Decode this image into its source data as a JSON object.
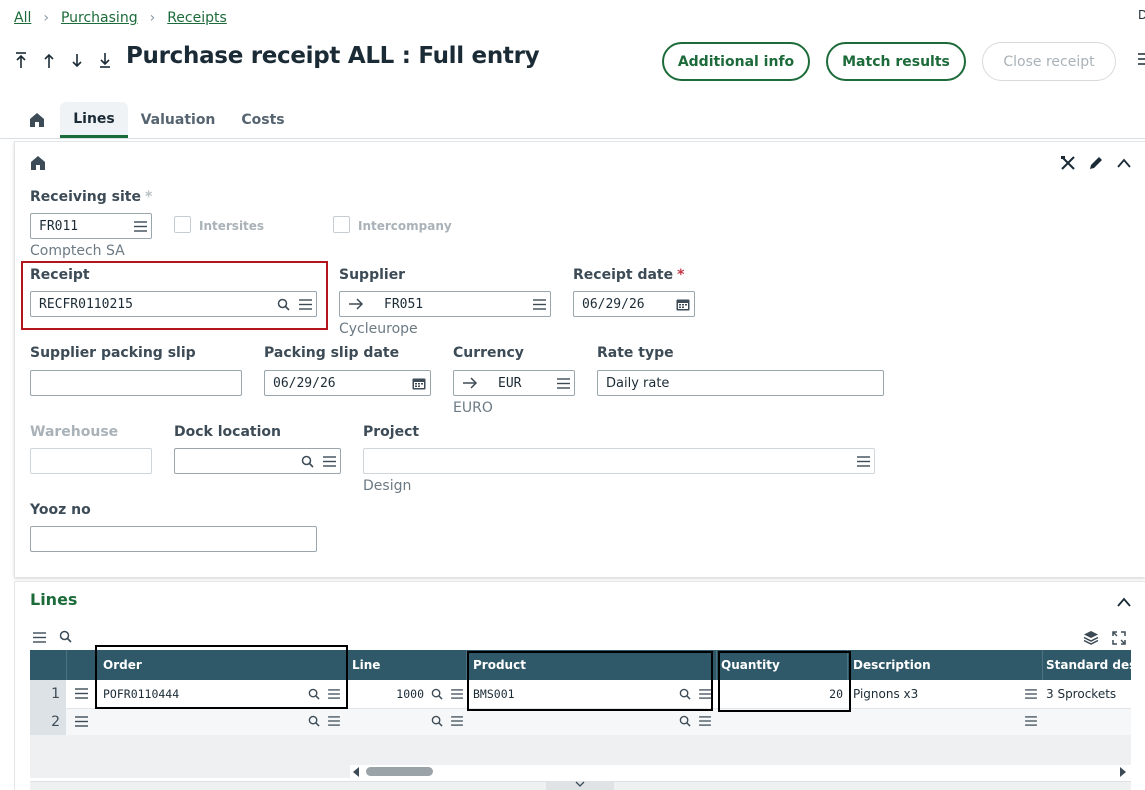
{
  "breadcrumb": [
    "All",
    "Purchasing",
    "Receipts"
  ],
  "title": "Purchase receipt ALL : Full entry",
  "buttons": {
    "additional_info": "Additional info",
    "match_results": "Match results",
    "close_receipt": "Close receipt"
  },
  "tabs": [
    "Lines",
    "Valuation",
    "Costs"
  ],
  "fields": {
    "receiving_site": {
      "label": "Receiving site",
      "value": "FR011",
      "desc": "Comptech SA"
    },
    "intersites": "Intersites",
    "intercompany": "Intercompany",
    "receipt": {
      "label": "Receipt",
      "value": "RECFR0110215"
    },
    "supplier": {
      "label": "Supplier",
      "value": "FR051",
      "desc": "Cycleurope"
    },
    "receipt_date": {
      "label": "Receipt date",
      "value": "06/29/26"
    },
    "supplier_packing_slip": {
      "label": "Supplier packing slip",
      "value": ""
    },
    "packing_slip_date": {
      "label": "Packing slip date",
      "value": "06/29/26"
    },
    "currency": {
      "label": "Currency",
      "value": "EUR",
      "desc": "EURO"
    },
    "rate_type": {
      "label": "Rate type",
      "value": "Daily rate"
    },
    "warehouse": {
      "label": "Warehouse",
      "value": ""
    },
    "dock_location": {
      "label": "Dock location",
      "value": ""
    },
    "project": {
      "label": "Project",
      "value": "",
      "desc": "Design"
    },
    "yooz_no": {
      "label": "Yooz no",
      "value": ""
    }
  },
  "lines_section": {
    "title": "Lines",
    "columns": [
      "Order",
      "Line",
      "Product",
      "Quantity",
      "Description",
      "Standard desc"
    ],
    "rows": [
      {
        "num": "1",
        "order": "POFR0110444",
        "line": "1000",
        "product": "BMS001",
        "quantity": "20",
        "description": "Pignons x3",
        "standard": "3 Sprockets"
      },
      {
        "num": "2",
        "order": "",
        "line": "",
        "product": "",
        "quantity": "",
        "description": "",
        "standard": ""
      }
    ]
  },
  "colors": {
    "accent": "#1d6b3a",
    "grid_header": "#2f5968",
    "highlight": "#b4141b"
  }
}
